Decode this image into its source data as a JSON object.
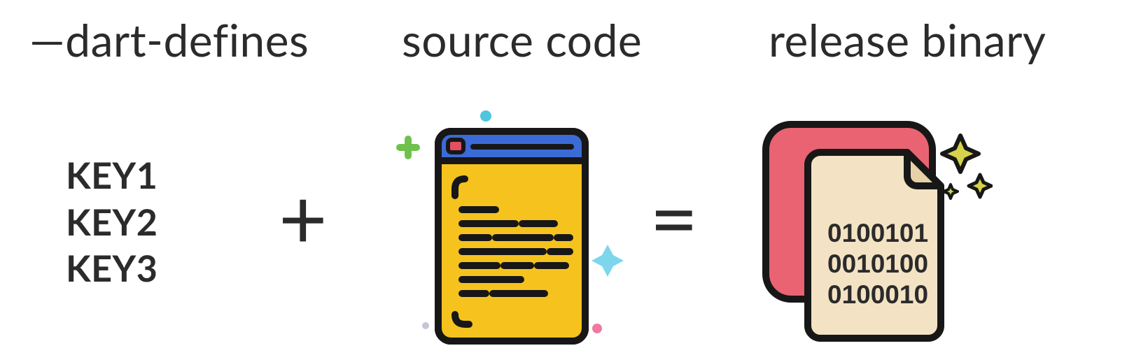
{
  "headings": {
    "defines": "—dart-defines",
    "source": "source code",
    "binary": "release binary"
  },
  "keys": [
    "KEY1",
    "KEY2",
    "KEY3"
  ],
  "operators": {
    "plus": "+",
    "equals": "="
  },
  "binary_lines": [
    "0100101",
    "0010100",
    "0100010"
  ],
  "colors": {
    "text": "#2b2b2b",
    "code_window_body": "#f6c31e",
    "code_window_titlebar": "#3b6bd6",
    "code_window_dot": "#e3505f",
    "outline": "#171717",
    "binary_back": "#e96373",
    "binary_front": "#f3e3c4",
    "sparkle_green": "#6ec24c",
    "sparkle_cyan": "#4ec6e0",
    "sparkle_pink": "#f17aa1",
    "sparkle_yellow": "#d6d24a"
  }
}
